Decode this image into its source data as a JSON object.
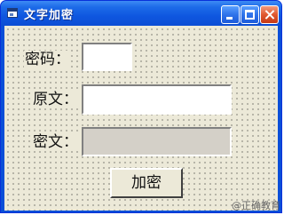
{
  "window": {
    "title": "文字加密",
    "icons": {
      "app": "window-app-icon",
      "min": "minimize-icon",
      "max": "maximize-icon",
      "close": "close-icon"
    },
    "colors": {
      "title_bar": "#0f57e0",
      "client": "#ece9d8",
      "close_button": "#e0582f"
    }
  },
  "form": {
    "password_label": "密码：",
    "password_value": "",
    "plaintext_label": "原文：",
    "plaintext_value": "",
    "ciphertext_label": "密文：",
    "ciphertext_value": "",
    "encrypt_button": "加密"
  },
  "watermark": "@正确教育"
}
